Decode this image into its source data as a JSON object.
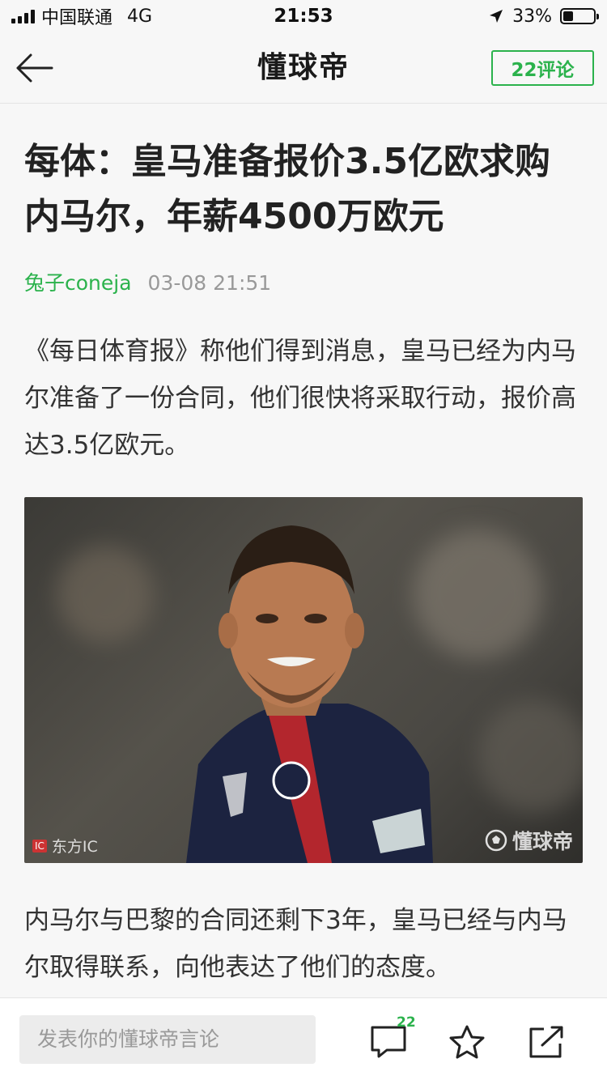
{
  "status_bar": {
    "carrier": "中国联通",
    "network": "4G",
    "time": "21:53",
    "battery_percent": "33%",
    "battery_level": 0.33
  },
  "nav": {
    "title": "懂球帝",
    "comment_count_label": "22评论"
  },
  "article": {
    "title": "每体：皇马准备报价3.5亿欧求购内马尔，年薪4500万欧元",
    "author": "兔子coneja",
    "timestamp": "03-08 21:51",
    "paragraph_1": "《每日体育报》称他们得到消息，皇马已经为内马尔准备了一份合同，他们很快将采取行动，报价高达3.5亿欧元。",
    "photo": {
      "watermark_left": "东方IC",
      "watermark_left_badge": "IC",
      "watermark_right": "懂球帝"
    },
    "paragraph_2": "内马尔与巴黎的合同还剩下3年，皇马已经与内马尔取得联系，向他表达了他们的态度。"
  },
  "bottom_bar": {
    "comment_placeholder": "发表你的懂球帝言论",
    "comment_badge": "22"
  },
  "colors": {
    "accent": "#2bb24c",
    "text": "#222222",
    "meta": "#999999"
  }
}
